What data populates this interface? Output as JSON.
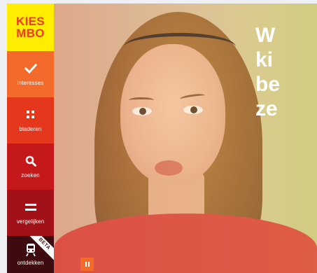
{
  "logo": {
    "text": "KIES\nMBO"
  },
  "nav": {
    "items": [
      {
        "label": "interesses",
        "icon": "check-icon"
      },
      {
        "label": "bladeren",
        "icon": "grid-icon"
      },
      {
        "label": "zoeken",
        "icon": "search-icon"
      },
      {
        "label": "vergelijken",
        "icon": "equals-icon"
      },
      {
        "label": "ontdekken",
        "icon": "train-icon",
        "badge": "BETA"
      }
    ]
  },
  "hero": {
    "headline": "W\nki\nbe\nze"
  },
  "controls": {
    "pause_icon": "pause-icon"
  },
  "colors": {
    "logo_bg": "#ffee00",
    "logo_text": "#ee3a24",
    "nav_1": "#f36a2b",
    "nav_2": "#e4371c",
    "nav_3": "#c4181a",
    "nav_4": "#a21118",
    "nav_5": "#3d0b10"
  }
}
